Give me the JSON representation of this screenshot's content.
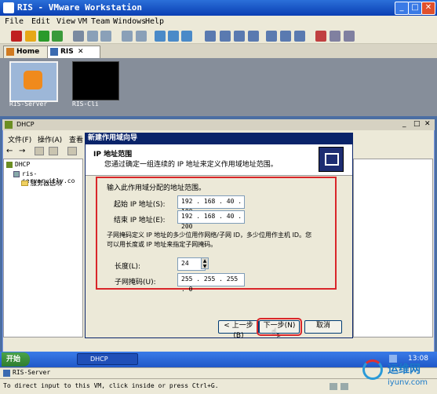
{
  "window": {
    "title": "RIS - VMware Workstation",
    "min": "_",
    "max": "□",
    "close": "✕"
  },
  "menu": [
    "File",
    "Edit",
    "View",
    "VM",
    "Team",
    "Windows",
    "Help"
  ],
  "tabs": [
    {
      "label": "Home"
    },
    {
      "label": "RIS"
    }
  ],
  "thumbnails": [
    {
      "label": "RIS-Server"
    },
    {
      "label": "RIS-Cli"
    }
  ],
  "mmc": {
    "title": "DHCP",
    "menu": [
      "文件(F)",
      "操作(A)",
      "查看"
    ],
    "tree": {
      "root": "DHCP",
      "server": "ris-server.itly.co",
      "options": "服务器选项"
    }
  },
  "wizard": {
    "title": "新建作用域向导",
    "heading": "IP 地址范围",
    "subheading": "您通过确定一组连续的 IP 地址来定义作用域地址范围。",
    "instruction": "输入此作用域分配的地址范围。",
    "start_label": "起始 IP 地址(S):",
    "start_value": "192 . 168 . 40 . 100",
    "end_label": "结束 IP 地址(E):",
    "end_value": "192 . 168 . 40 . 200",
    "mask_note_1": "子网掩码定义 IP 地址的多少位用作网络/子网 ID，多少位用作主机 ID。您",
    "mask_note_2": "可以用长度或 IP 地址来指定子网掩码。",
    "length_label": "长度(L):",
    "length_value": "24",
    "mask_label": "子网掩码(U):",
    "mask_value": "255 . 255 . 255 . 0",
    "back": "< 上一步(B)",
    "next": "下一步(N) >",
    "cancel": "取消"
  },
  "taskbar": {
    "start": "开始",
    "task": "DHCP",
    "clock": "13:08"
  },
  "status": {
    "vm": "RIS-Server",
    "hint": "To direct input to this VM, click inside or press Ctrl+G."
  },
  "watermark": {
    "text": "运维网",
    "url": "iyunv.com"
  }
}
